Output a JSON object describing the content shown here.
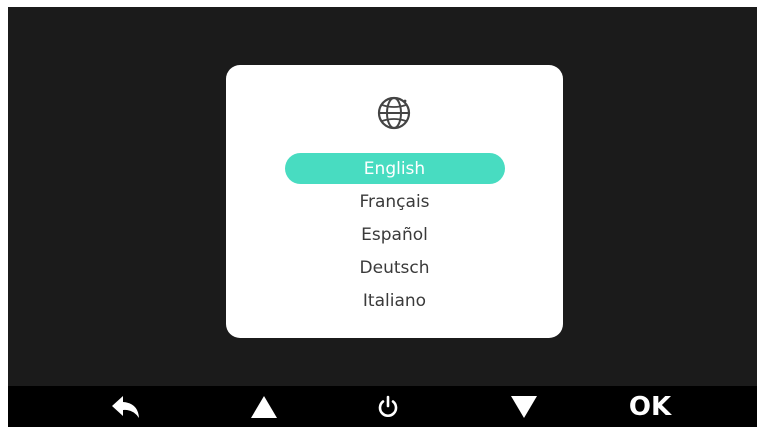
{
  "dialog": {
    "icon": "globe-icon",
    "languages": [
      {
        "label": "English",
        "selected": true
      },
      {
        "label": "Français",
        "selected": false
      },
      {
        "label": "Español",
        "selected": false
      },
      {
        "label": "Deutsch",
        "selected": false
      },
      {
        "label": "Italiano",
        "selected": false
      }
    ]
  },
  "toolbar": {
    "buttons": [
      {
        "icon": "back-arrow-icon"
      },
      {
        "icon": "up-triangle-icon"
      },
      {
        "icon": "power-icon"
      },
      {
        "icon": "down-triangle-icon"
      },
      {
        "label": "OK"
      }
    ]
  },
  "colors": {
    "screen_background": "#1b1b1b",
    "dialog_background": "#ffffff",
    "selection_accent": "#48dcc1",
    "toolbar_background": "#000000"
  }
}
